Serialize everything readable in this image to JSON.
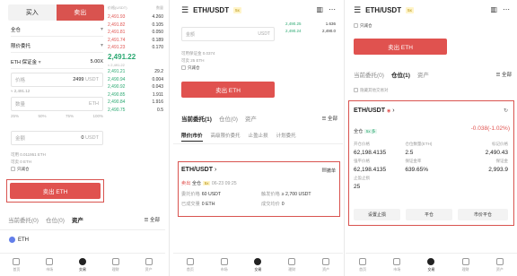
{
  "panel1": {
    "buy_label": "买入",
    "sell_label": "卖出",
    "account_mode": "全仓",
    "order_type": "限价委托",
    "pair_short": "ETH",
    "pair_suffix": "保证金",
    "leverage": "5.00X",
    "price_label": "价格",
    "price_value": "2499",
    "price_unit": "USDT",
    "price_approx": "≈ 2,491.12",
    "qty_label": "数量",
    "qty_unit": "ETH",
    "pct": [
      "25%",
      "50%",
      "75%",
      "100%"
    ],
    "total_label": "金额",
    "total_value": "0",
    "total_unit": "USDT",
    "avail_label": "可用 0.011951 ETH",
    "max_label": "可卖 0 ETH",
    "checkbox_label": "只减仓",
    "sell_btn": "卖出 ETH",
    "book": {
      "head_price": "价格(USDT)",
      "head_qty": "数量",
      "asks": [
        {
          "p": "2,491.93",
          "q": "4.260"
        },
        {
          "p": "2,491.82",
          "q": "0.105"
        },
        {
          "p": "2,491.81",
          "q": "0.050"
        },
        {
          "p": "2,491.74",
          "q": "0.189"
        },
        {
          "p": "2,491.23",
          "q": "0.170"
        }
      ],
      "last": "2,491.22",
      "last_sub": "≈ 2,491.22",
      "bids": [
        {
          "p": "2,491.21",
          "q": "29.2"
        },
        {
          "p": "2,490.94",
          "q": "0.004"
        },
        {
          "p": "2,490.92",
          "q": "0.043"
        },
        {
          "p": "2,490.85",
          "q": "1.911"
        },
        {
          "p": "2,490.84",
          "q": "1.916"
        },
        {
          "p": "2,490.75",
          "q": "0.5"
        }
      ]
    },
    "tabs": [
      "当前委托(0)",
      "仓位(0)",
      "资产"
    ],
    "all_label": "全部",
    "asset_label": "ETH"
  },
  "panel2": {
    "title": "ETH/USDT",
    "badge": "5x",
    "price_placeholder": "金额",
    "price_unit": "USDT",
    "right_price": "2,490.25",
    "right_q": "1.636",
    "right_p2": "2,490.24",
    "right_q2": "2,490.0",
    "avail": "可用保证金 0.0374",
    "max_eth": "可卖 25 ETH",
    "checkbox": "只减仓",
    "sell_btn": "卖出 ETH",
    "tabs": [
      "当前委托(1)",
      "仓位(0)",
      "资产"
    ],
    "all_label": "全部",
    "subtabs": [
      "限价|市价",
      "高级限价委托",
      "止盈止损",
      "计划委托"
    ],
    "card_pair": "ETH/USDT",
    "card_cancel": "撤单",
    "side": "卖出",
    "mode": "全仓",
    "lev": "5x",
    "time": "06-23 09:25",
    "price_k": "委托价格",
    "price_v": "60 USDT",
    "trigger_k": "触发价格",
    "trigger_v": "≥ 2,700 USDT",
    "filled_k": "已成交量",
    "filled_v": "0 ETH",
    "status_k": "成交均价",
    "status_v": "0"
  },
  "panel3": {
    "title": "ETH/USDT",
    "badge": "5x",
    "checkbox": "只减仓",
    "sell_btn": "卖出 ETH",
    "tabs": [
      "当前委托(0)",
      "仓位(1)",
      "资产"
    ],
    "all_label": "全部",
    "filter": "隐藏其他交易对",
    "pos_pair": "ETH/USDT",
    "pos_pnl": "-0.038(-1.02%)",
    "pos_side": "全仓",
    "pos_lev": "5x 多",
    "col1_k": "开仓价格",
    "col2_k": "仓位数量(ETH)",
    "col3_k": "标记价格",
    "col1_v": "62,198.4135",
    "col2_v": "2.5",
    "col3_v": "2,490.43",
    "col4_k": "强平价格",
    "col5_k": "保证金率",
    "col6_k": "保证金",
    "col4_v": "62,198.4135",
    "col5_v": "639.65%",
    "col6_v": "2,993.9",
    "col7_k": "止盈止损",
    "col7_v": "25",
    "btns": [
      "设置止损",
      "平仓",
      "市价平仓"
    ]
  },
  "nav": [
    "首页",
    "市场",
    "交易",
    "理财",
    "资产"
  ]
}
